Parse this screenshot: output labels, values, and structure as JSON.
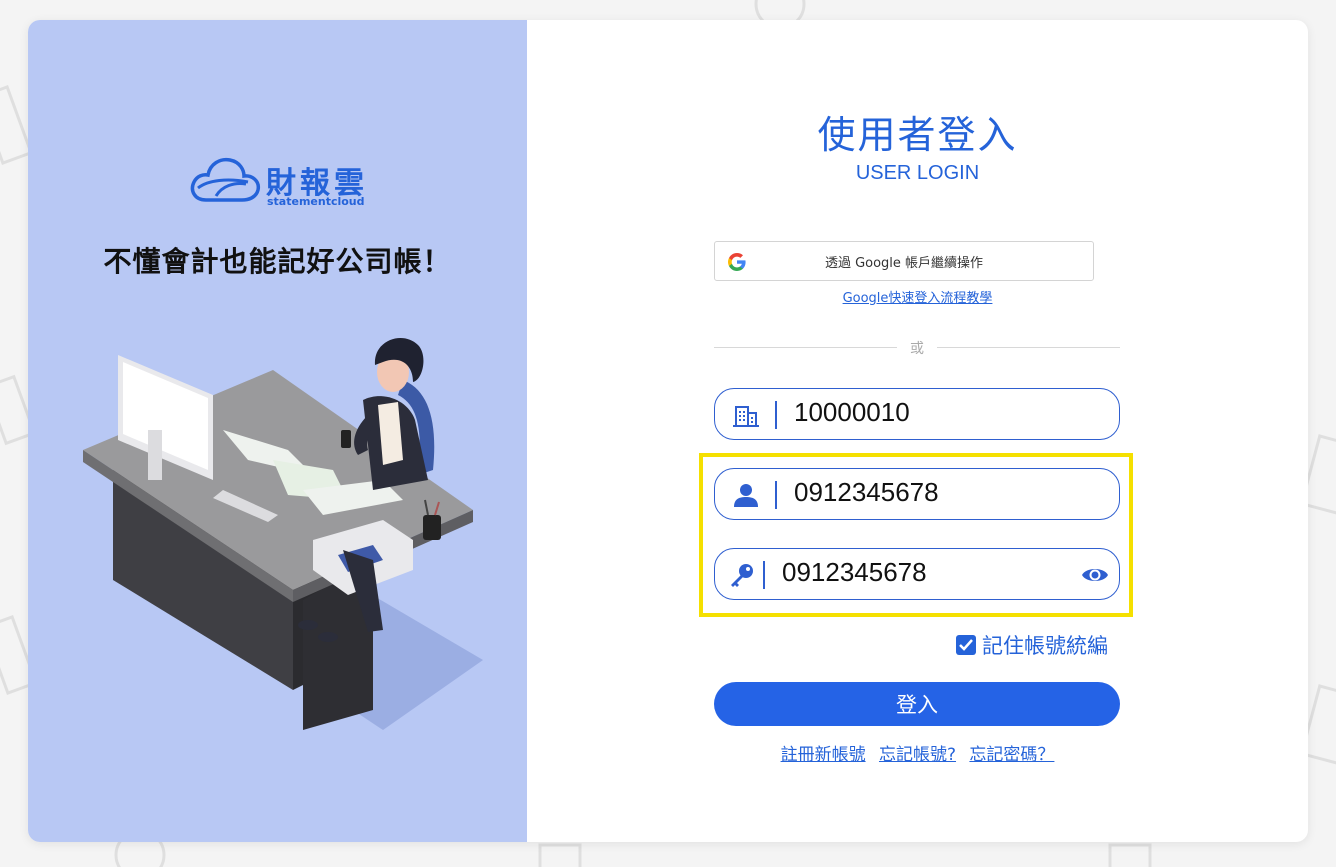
{
  "brand": {
    "name": "財報雲",
    "sub": "statementcloud",
    "slogan": "不懂會計也能記好公司帳！"
  },
  "login": {
    "title": "使用者登入",
    "subtitle": "USER LOGIN",
    "google_button": "透過 Google 帳戶繼續操作",
    "google_help": "Google快速登入流程教學",
    "or": "或",
    "company_id": "10000010",
    "account": "0912345678",
    "password": "0912345678",
    "remember_label": "記住帳號統編",
    "remember_checked": true,
    "submit": "登入",
    "links": {
      "register": "註冊新帳號",
      "forgot_account": "忘記帳號?",
      "forgot_password": "忘記密碼？"
    }
  },
  "colors": {
    "accent": "#2563d9",
    "left_panel": "#b8c8f4",
    "highlight": "#f5e000",
    "button": "#2563e6"
  },
  "icons": [
    "google-icon",
    "building-icon",
    "user-icon",
    "key-icon",
    "eye-icon",
    "checkbox-check-icon",
    "cloud-logo-icon"
  ]
}
